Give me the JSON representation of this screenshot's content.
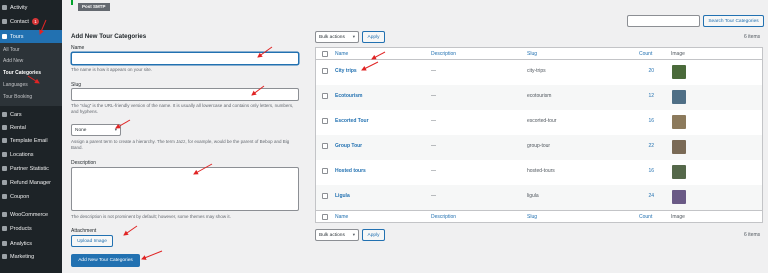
{
  "sidebar": {
    "items": [
      {
        "label": "Activity",
        "icon": "activity-icon"
      },
      {
        "label": "Contact",
        "icon": "mail-icon",
        "badge": "1"
      },
      {
        "label": "Tours",
        "icon": "tours-icon",
        "current": true
      },
      {
        "label": "Cars",
        "icon": "car-icon"
      },
      {
        "label": "Rental",
        "icon": "rental-icon"
      },
      {
        "label": "Template Email",
        "icon": "template-icon"
      },
      {
        "label": "Locations",
        "icon": "location-icon"
      },
      {
        "label": "Partner Statistic",
        "icon": "statistic-icon"
      },
      {
        "label": "Refund Manager",
        "icon": "refund-icon"
      },
      {
        "label": "Coupon",
        "icon": "coupon-icon"
      },
      {
        "label": "WooCommerce",
        "icon": "woocommerce-icon"
      },
      {
        "label": "Products",
        "icon": "products-icon"
      },
      {
        "label": "Analytics",
        "icon": "analytics-icon"
      },
      {
        "label": "Marketing",
        "icon": "marketing-icon"
      }
    ],
    "submenu": [
      "All Tour",
      "Add New",
      "Tour Categories",
      "Languages",
      "Tour Booking"
    ]
  },
  "notice": {
    "tab": "Post SMTP"
  },
  "form": {
    "title": "Add New Tour Categories",
    "name_label": "Name",
    "name_help": "The name is how it appears on your site.",
    "slug_label": "Slug",
    "slug_help": "The “slug” is the URL-friendly version of the name. It is usually all lowercase and contains only letters, numbers, and hyphens.",
    "parent_value": "None",
    "parent_help": "Assign a parent term to create a hierarchy. The term Jazz, for example, would be the parent of Bebop and Big Band.",
    "desc_label": "Description",
    "desc_help": "The description is not prominent by default; however, some themes may show it.",
    "attachment_label": "Attachment",
    "upload_button": "Upload Image",
    "submit_button": "Add New Tour Categories"
  },
  "search": {
    "button": "Search Tour Categories",
    "placeholder": ""
  },
  "bulk": {
    "label": "Bulk actions",
    "apply": "Apply",
    "items_count": "6 items"
  },
  "table": {
    "headers": {
      "name": "Name",
      "description": "Description",
      "slug": "Slug",
      "count": "Count",
      "image": "Image"
    },
    "rows": [
      {
        "name": "City trips",
        "description": "—",
        "slug": "city-trips",
        "count": "20",
        "thumb": "#4a6a3a"
      },
      {
        "name": "Ecotourism",
        "description": "—",
        "slug": "ecotourism",
        "count": "12",
        "thumb": "#4f6f86"
      },
      {
        "name": "Escorted Tour",
        "description": "—",
        "slug": "escorted-tour",
        "count": "16",
        "thumb": "#8c7a5c"
      },
      {
        "name": "Group Tour",
        "description": "—",
        "slug": "group-tour",
        "count": "22",
        "thumb": "#7a6a56"
      },
      {
        "name": "Hosted tours",
        "description": "—",
        "slug": "hosted-tours",
        "count": "16",
        "thumb": "#55684a"
      },
      {
        "name": "Ligula",
        "description": "—",
        "slug": "ligula",
        "count": "24",
        "thumb": "#6a5a86"
      }
    ]
  },
  "colors": {
    "accent": "#2271b1",
    "sidebar": "#1d2327",
    "annotation": "#e02424"
  }
}
